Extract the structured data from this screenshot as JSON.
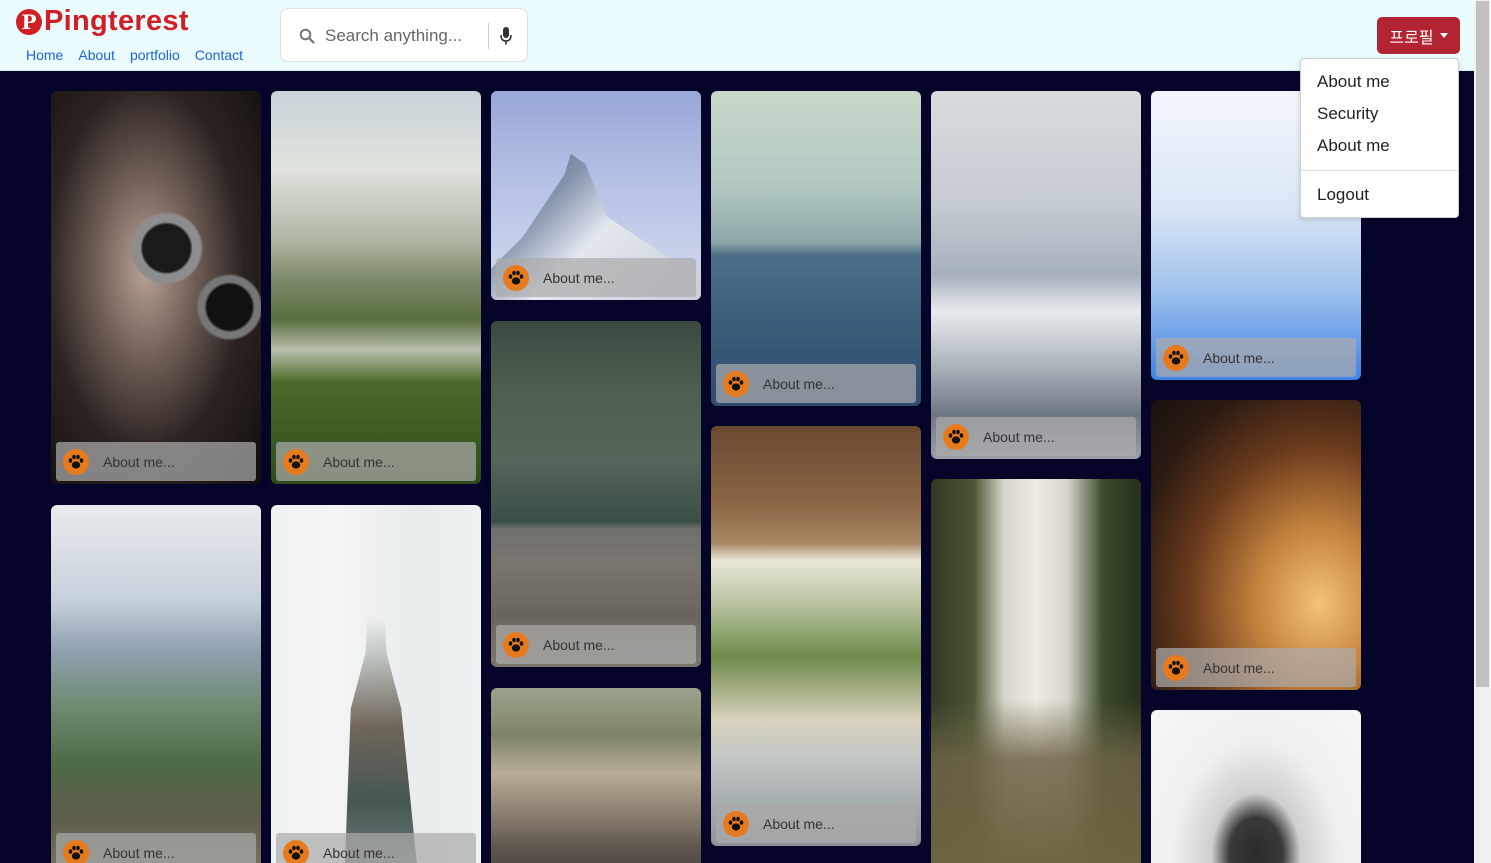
{
  "brand": {
    "logo_letter": "P",
    "name": "Pingterest"
  },
  "nav": [
    "Home",
    "About",
    "portfolio",
    "Contact"
  ],
  "search": {
    "placeholder": "Search anything..."
  },
  "profile": {
    "label": "프로필"
  },
  "dropdown": {
    "items": [
      "About me",
      "Security",
      "About me"
    ],
    "logout": "Logout"
  },
  "card_caption": "About me...",
  "colors": {
    "accent": "#b32432",
    "brand": "#d11f26",
    "background": "#05052a",
    "paw": "#e87a1e"
  },
  "cards": [
    {
      "icon": "camera-photo",
      "caption": "About me..."
    },
    {
      "icon": "river-forest-photo",
      "caption": "About me..."
    },
    {
      "icon": "mountain-peak-photo",
      "caption": "About me..."
    },
    {
      "icon": "sea-ship-photo",
      "caption": "About me..."
    },
    {
      "icon": "snowy-mountain-photo",
      "caption": "About me..."
    },
    {
      "icon": "jellyfish-photo",
      "caption": "About me..."
    },
    {
      "icon": "aerial-forest-photo",
      "caption": "About me..."
    },
    {
      "icon": "car-mirror-photo",
      "caption": "About me..."
    },
    {
      "icon": "girl-dress-photo",
      "caption": "About me..."
    },
    {
      "icon": "woman-sunset-photo",
      "caption": "About me..."
    },
    {
      "icon": "mountain-range-photo",
      "caption": "About me..."
    },
    {
      "icon": "tower-woman-photo",
      "caption": "About me..."
    },
    {
      "icon": "city-street-photo",
      "caption": "About me..."
    },
    {
      "icon": "typewriter-photo",
      "caption": "About me..."
    }
  ]
}
